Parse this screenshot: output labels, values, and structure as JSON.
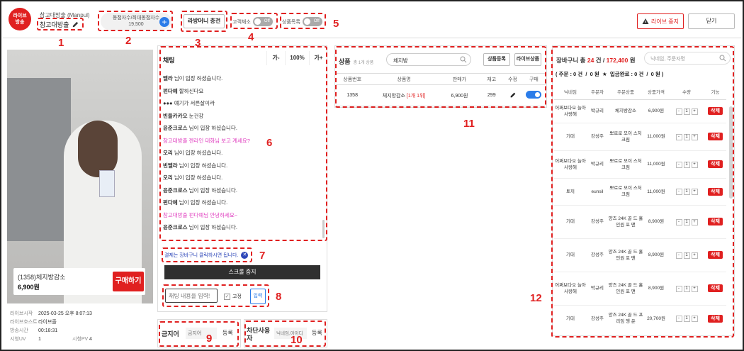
{
  "header": {
    "live_badge": "라이브\n방송",
    "channel_sub": "참고대방출 (Manpul)",
    "channel_name": "참고대방출",
    "viewer_label": "동접자수/최대동접자수",
    "viewer_count": "19,500",
    "coupon_button": "라방머니 충전",
    "toggle1_label": "고객채소",
    "toggle2_label": "상품목록",
    "toggle_off": "Off",
    "stop_button": "라이브 중지",
    "close_button": "닫기"
  },
  "video": {
    "product_title": "(1358)체지방감소",
    "product_price": "6,900원",
    "buy_button": "구매하기",
    "info": [
      {
        "label": "라이브시작",
        "value": "2025-03-25 오후 8:07:13"
      },
      {
        "label": "라이브호스트",
        "value": "라이브즐"
      },
      {
        "label": "방송시간",
        "value": "00:18:31"
      }
    ],
    "stats": {
      "uv_label": "시청UV",
      "uv_value": "1",
      "pv_label": "시청PV",
      "pv_value": "4"
    }
  },
  "chat": {
    "title": "채팅",
    "font_small": "가-",
    "font_size": "100%",
    "font_large": "가+",
    "messages": [
      {
        "name": "벨라",
        "text": "님이 입장 하셨습니다.",
        "color": ""
      },
      {
        "name": "펀다예",
        "text": "할하신다요",
        "color": ""
      },
      {
        "name": "●●●",
        "text": "얘기가 서른살이라",
        "color": ""
      },
      {
        "name": "빈들카카오",
        "text": "눈건강",
        "color": ""
      },
      {
        "name": "윤준크로스",
        "text": "님이 입장 하셨습니다.",
        "color": ""
      },
      {
        "name": "참고대방출",
        "text": "젠라인 대화님 보고 계세요?",
        "color": "#e040c0"
      },
      {
        "name": "오리",
        "text": "님이 입장 하셨습니다.",
        "color": ""
      },
      {
        "name": "빈벨라",
        "text": "님이 입장 하셨습니다.",
        "color": ""
      },
      {
        "name": "오리",
        "text": "님이 입장 하셨습니다.",
        "color": ""
      },
      {
        "name": "윤준크로스",
        "text": "님이 입장 하셨습니다.",
        "color": ""
      },
      {
        "name": "펀다예",
        "text": "님이 입장 하셨습니다.",
        "color": ""
      },
      {
        "name": "참고대방출",
        "text": "펀다예님 안녕하세요~",
        "color": "#e040c0"
      },
      {
        "name": "윤준크로스",
        "text": "님이 입장 하셨습니다.",
        "color": ""
      }
    ],
    "notice": "결제는 장바구니 클릭하시면 됩니다.",
    "scroll_stop": "스크롤 중지",
    "input_placeholder": "채팅 내용을 입력!",
    "fix_label": "고정",
    "send_button": "입력"
  },
  "banned_words": {
    "title": "금지어",
    "placeholder": "금지어",
    "button": "등록"
  },
  "blocked_users": {
    "title": "차단사용자",
    "placeholder": "닉네임,아이디",
    "button": "등록"
  },
  "products": {
    "title": "상품",
    "count": "총 1개 상품",
    "search_value": "체지방",
    "register_button": "상품등록",
    "live_button": "라이브상품",
    "columns": [
      "상품번호",
      "상품명",
      "판매가",
      "재고",
      "수정",
      "구매"
    ],
    "rows": [
      {
        "id": "1358",
        "name": "체지방감소",
        "tag": "[1개 1위]",
        "price": "6,900원",
        "stock": "299"
      }
    ]
  },
  "cart": {
    "title_prefix": "장바구니 총",
    "count": "24",
    "count_unit": "건 /",
    "total": "172,400",
    "total_unit": "원",
    "search_placeholder": "닉네임, 주문자명",
    "order_summary": "( 주문 : 0 건  /  0 원  ★  입금완료 : 0 건  /  0 원 )",
    "columns": [
      "닉네임",
      "주문자",
      "주문상품",
      "상품가격",
      "수량",
      "기능"
    ],
    "delete_label": "삭제",
    "rows": [
      {
        "nick": "어쩌보다오 늘아사랑해",
        "orderer": "박규리",
        "product": "체지방감소",
        "price": "6,900원",
        "qty": "1"
      },
      {
        "nick": "기대",
        "orderer": "강성주",
        "product": "뽀로로 모이 스처 크림",
        "price": "11,000원",
        "qty": "1"
      },
      {
        "nick": "어쩌보다오 늘아사랑해",
        "orderer": "박규리",
        "product": "뽀로로 모이 스처 크림",
        "price": "11,000원",
        "qty": "1"
      },
      {
        "nick": "토끼",
        "orderer": "eunsil",
        "product": "뽀로로 모이 스처 크림",
        "price": "11,000원",
        "qty": "1"
      },
      {
        "nick": "기대",
        "orderer": "강성주",
        "product": "양즈 24K 골 드 홀인원 포 맨",
        "price": "8,900원",
        "qty": "1"
      },
      {
        "nick": "기대",
        "orderer": "강성주",
        "product": "양즈 24K 골 드 홀인원 포 맨",
        "price": "8,900원",
        "qty": "1"
      },
      {
        "nick": "어쩌보다오 늘아사랑해",
        "orderer": "박규리",
        "product": "양즈 24K 골 드 홀인원 포 맨",
        "price": "8,900원",
        "qty": "1"
      },
      {
        "nick": "기대",
        "orderer": "강성주",
        "product": "양즈 24K 골 드 프리임 행 운",
        "price": "20,700원",
        "qty": "1"
      }
    ]
  },
  "annotations": [
    "1",
    "2",
    "3",
    "4",
    "5",
    "6",
    "7",
    "8",
    "9",
    "10",
    "11",
    "12"
  ]
}
